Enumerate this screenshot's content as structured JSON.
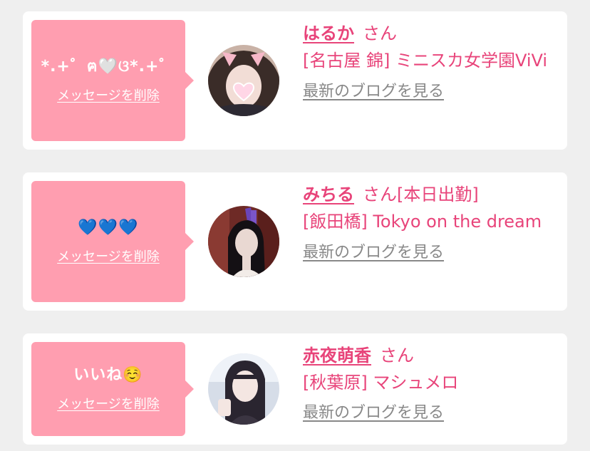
{
  "colors": {
    "background": "#efefef",
    "card": "#ffffff",
    "bubble": "#ff9eb0",
    "accent": "#e8447a",
    "link_gray": "#888888"
  },
  "messages": [
    {
      "message": "*.+゜ฅ🤍ଓ*.+゜",
      "delete_label": "メッセージを削除",
      "name": "はるか",
      "suffix": "さん",
      "shop": "[名古屋 錦] ミニスカ女学園ViVi",
      "blog_link": "最新のブログを見る",
      "avatar_icon": "profile-photo-icon"
    },
    {
      "message": "💙💙💙",
      "delete_label": "メッセージを削除",
      "name": "みちる",
      "suffix": "さん[本日出勤]",
      "shop": "[飯田橋] Tokyo on the dream",
      "blog_link": "最新のブログを見る",
      "avatar_icon": "profile-photo-icon"
    },
    {
      "message": "いいね☺️",
      "delete_label": "メッセージを削除",
      "name": "赤夜萌香",
      "suffix": "さん",
      "shop": "[秋葉原] マシュメロ",
      "blog_link": "最新のブログを見る",
      "avatar_icon": "profile-photo-icon"
    }
  ]
}
